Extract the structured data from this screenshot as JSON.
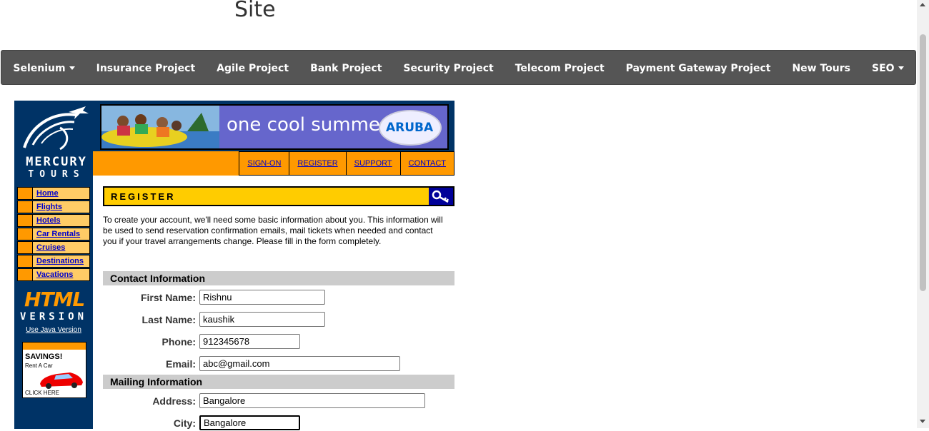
{
  "site": {
    "title": "Site"
  },
  "nav": {
    "items": [
      {
        "label": "Selenium",
        "dropdown": true
      },
      {
        "label": "Insurance Project",
        "dropdown": false
      },
      {
        "label": "Agile Project",
        "dropdown": false
      },
      {
        "label": "Bank Project",
        "dropdown": false
      },
      {
        "label": "Security Project",
        "dropdown": false
      },
      {
        "label": "Telecom Project",
        "dropdown": false
      },
      {
        "label": "Payment Gateway Project",
        "dropdown": false
      },
      {
        "label": "New Tours",
        "dropdown": false
      },
      {
        "label": "SEO",
        "dropdown": true
      }
    ]
  },
  "logo": {
    "line1": "MERCURY",
    "line2": "TOURS"
  },
  "sidebar": {
    "items": [
      {
        "label": "Home"
      },
      {
        "label": "Flights"
      },
      {
        "label": "Hotels"
      },
      {
        "label": "Car Rentals"
      },
      {
        "label": "Cruises"
      },
      {
        "label": "Destinations"
      },
      {
        "label": "Vacations"
      }
    ],
    "html_version": {
      "big": "HTML",
      "small": "VERSION"
    },
    "java_link": "Use Java Version",
    "ad": {
      "title": "SAVINGS!",
      "subtitle": "Rent A Car",
      "cta": "CLICK HERE"
    }
  },
  "banner": {
    "text": "one cool summer",
    "brand": "ARUBA"
  },
  "topnav": {
    "links": [
      {
        "label": "SIGN-ON"
      },
      {
        "label": "REGISTER"
      },
      {
        "label": "SUPPORT"
      },
      {
        "label": "CONTACT"
      }
    ]
  },
  "register": {
    "title": "REGISTER",
    "intro": "To create your account, we'll need some basic information about you. This information will be used to send reservation confirmation emails, mail tickets when needed and contact you if your travel arrangements change. Please fill in the form completely.",
    "contact_section": "Contact Information",
    "mailing_section": "Mailing Information",
    "fields": {
      "first_name": {
        "label": "First Name:",
        "value": "Rishnu"
      },
      "last_name": {
        "label": "Last Name:",
        "value": "kaushik"
      },
      "phone": {
        "label": "Phone:",
        "value": "912345678"
      },
      "email": {
        "label": "Email:",
        "value": "abc@gmail.com"
      },
      "address": {
        "label": "Address:",
        "value": "Bangalore"
      },
      "city": {
        "label": "City:",
        "value": "Bangalore"
      }
    }
  },
  "colors": {
    "navbar": "#555555",
    "sidebar_bg": "#003366",
    "orange": "#ff9900",
    "yellow": "#ffcc00",
    "link": "#0000cc"
  }
}
